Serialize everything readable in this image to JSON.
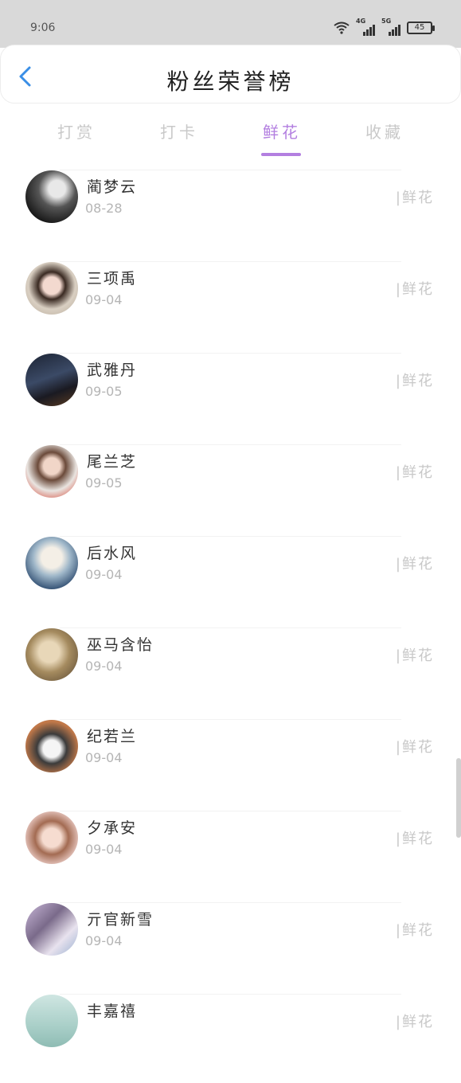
{
  "status": {
    "time": "9:06",
    "net1": "4G",
    "net2": "5G",
    "battery": "45"
  },
  "header": {
    "title": "粉丝荣誉榜"
  },
  "tabs": [
    {
      "label": "打赏"
    },
    {
      "label": "打卡"
    },
    {
      "label": "鲜花"
    },
    {
      "label": "收藏"
    }
  ],
  "list": [
    {
      "name": "蔺梦云",
      "date": "08-28",
      "meta": "|鲜花"
    },
    {
      "name": "三项禹",
      "date": "09-04",
      "meta": "|鲜花"
    },
    {
      "name": "武雅丹",
      "date": "09-05",
      "meta": "|鲜花"
    },
    {
      "name": "尾兰芝",
      "date": "09-05",
      "meta": "|鲜花"
    },
    {
      "name": "后水风",
      "date": "09-04",
      "meta": "|鲜花"
    },
    {
      "name": "巫马含怡",
      "date": "09-04",
      "meta": "|鲜花"
    },
    {
      "name": "纪若兰",
      "date": "09-04",
      "meta": "|鲜花"
    },
    {
      "name": "夕承安",
      "date": "09-04",
      "meta": "|鲜花"
    },
    {
      "name": "亓官新雪",
      "date": "09-04",
      "meta": "|鲜花"
    },
    {
      "name": "丰嘉禧",
      "date": "",
      "meta": "|鲜花"
    }
  ],
  "colors": {
    "accent": "#b37fe0",
    "back_arrow": "#3a8ee6"
  }
}
